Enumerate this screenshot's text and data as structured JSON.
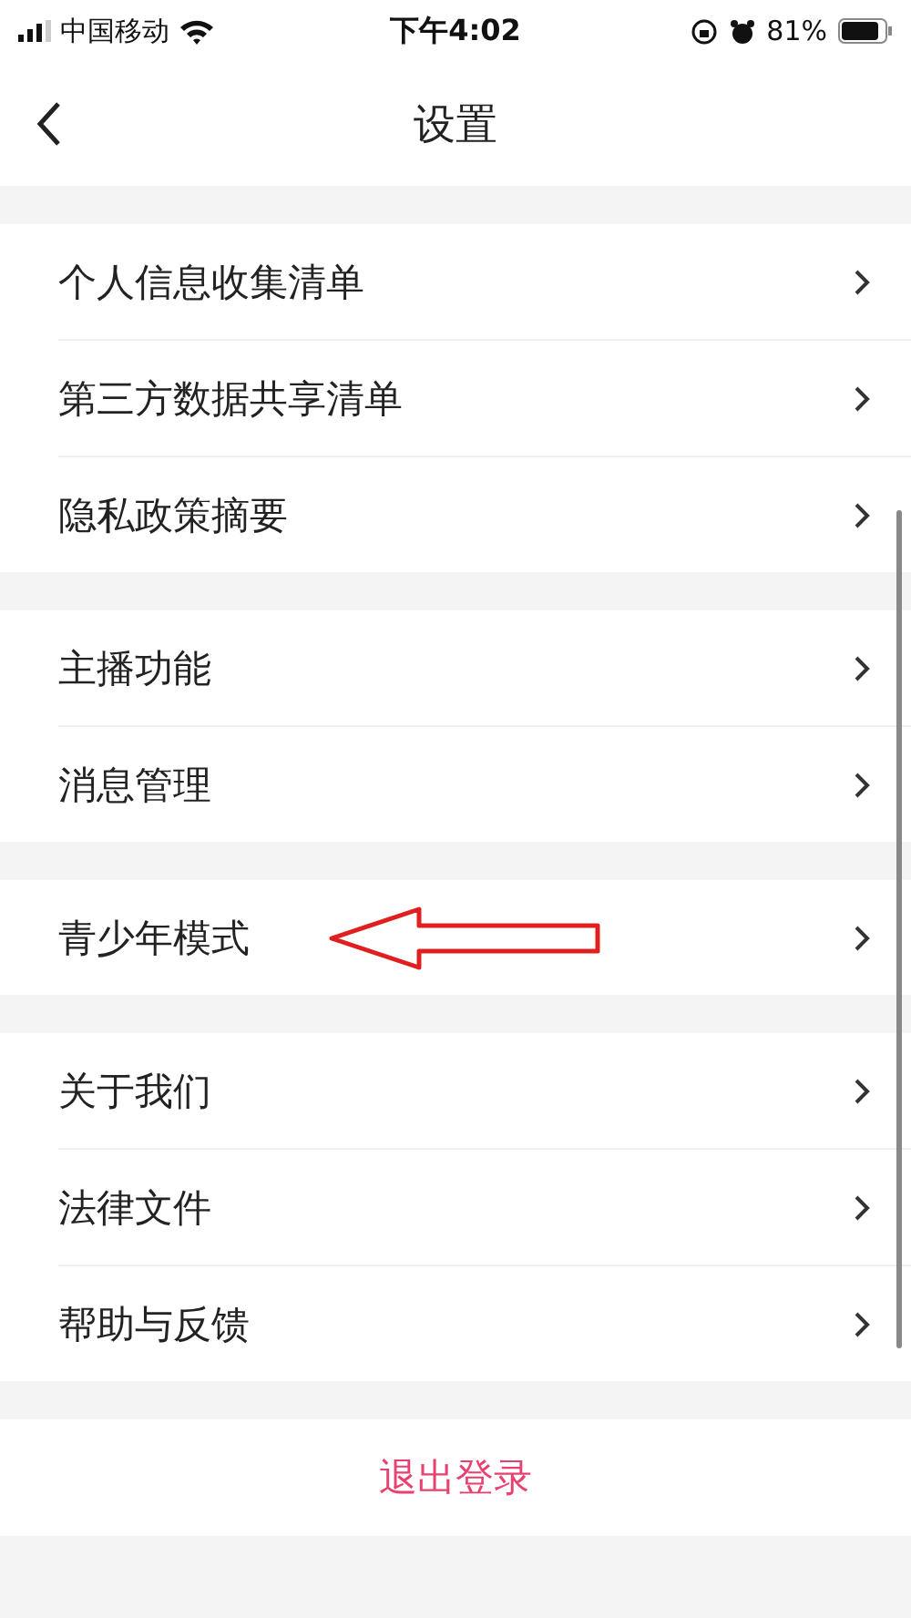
{
  "status_bar": {
    "carrier": "中国移动",
    "time": "下午4:02",
    "battery": "81%"
  },
  "nav": {
    "title": "设置"
  },
  "groups": [
    {
      "items": [
        {
          "label": "个人信息收集清单",
          "annotated": false
        },
        {
          "label": "第三方数据共享清单",
          "annotated": false
        },
        {
          "label": "隐私政策摘要",
          "annotated": false
        }
      ]
    },
    {
      "items": [
        {
          "label": "主播功能",
          "annotated": false
        },
        {
          "label": "消息管理",
          "annotated": false
        }
      ]
    },
    {
      "items": [
        {
          "label": "青少年模式",
          "annotated": true
        }
      ]
    },
    {
      "items": [
        {
          "label": "关于我们",
          "annotated": false
        },
        {
          "label": "法律文件",
          "annotated": false
        },
        {
          "label": "帮助与反馈",
          "annotated": false
        }
      ]
    }
  ],
  "logout": {
    "label": "退出登录"
  }
}
